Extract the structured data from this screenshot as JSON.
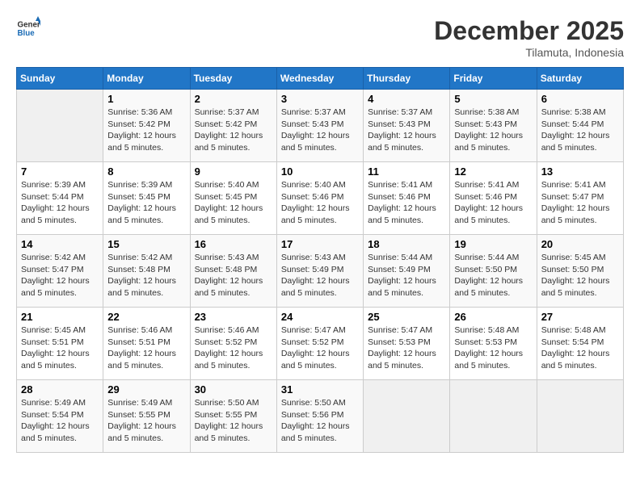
{
  "header": {
    "logo_general": "General",
    "logo_blue": "Blue",
    "month": "December 2025",
    "location": "Tilamuta, Indonesia"
  },
  "columns": [
    "Sunday",
    "Monday",
    "Tuesday",
    "Wednesday",
    "Thursday",
    "Friday",
    "Saturday"
  ],
  "weeks": [
    [
      {
        "day": "",
        "info": ""
      },
      {
        "day": "1",
        "info": "Sunrise: 5:36 AM\nSunset: 5:42 PM\nDaylight: 12 hours\nand 5 minutes."
      },
      {
        "day": "2",
        "info": "Sunrise: 5:37 AM\nSunset: 5:42 PM\nDaylight: 12 hours\nand 5 minutes."
      },
      {
        "day": "3",
        "info": "Sunrise: 5:37 AM\nSunset: 5:43 PM\nDaylight: 12 hours\nand 5 minutes."
      },
      {
        "day": "4",
        "info": "Sunrise: 5:37 AM\nSunset: 5:43 PM\nDaylight: 12 hours\nand 5 minutes."
      },
      {
        "day": "5",
        "info": "Sunrise: 5:38 AM\nSunset: 5:43 PM\nDaylight: 12 hours\nand 5 minutes."
      },
      {
        "day": "6",
        "info": "Sunrise: 5:38 AM\nSunset: 5:44 PM\nDaylight: 12 hours\nand 5 minutes."
      }
    ],
    [
      {
        "day": "7",
        "info": "Sunrise: 5:39 AM\nSunset: 5:44 PM\nDaylight: 12 hours\nand 5 minutes."
      },
      {
        "day": "8",
        "info": "Sunrise: 5:39 AM\nSunset: 5:45 PM\nDaylight: 12 hours\nand 5 minutes."
      },
      {
        "day": "9",
        "info": "Sunrise: 5:40 AM\nSunset: 5:45 PM\nDaylight: 12 hours\nand 5 minutes."
      },
      {
        "day": "10",
        "info": "Sunrise: 5:40 AM\nSunset: 5:46 PM\nDaylight: 12 hours\nand 5 minutes."
      },
      {
        "day": "11",
        "info": "Sunrise: 5:41 AM\nSunset: 5:46 PM\nDaylight: 12 hours\nand 5 minutes."
      },
      {
        "day": "12",
        "info": "Sunrise: 5:41 AM\nSunset: 5:46 PM\nDaylight: 12 hours\nand 5 minutes."
      },
      {
        "day": "13",
        "info": "Sunrise: 5:41 AM\nSunset: 5:47 PM\nDaylight: 12 hours\nand 5 minutes."
      }
    ],
    [
      {
        "day": "14",
        "info": "Sunrise: 5:42 AM\nSunset: 5:47 PM\nDaylight: 12 hours\nand 5 minutes."
      },
      {
        "day": "15",
        "info": "Sunrise: 5:42 AM\nSunset: 5:48 PM\nDaylight: 12 hours\nand 5 minutes."
      },
      {
        "day": "16",
        "info": "Sunrise: 5:43 AM\nSunset: 5:48 PM\nDaylight: 12 hours\nand 5 minutes."
      },
      {
        "day": "17",
        "info": "Sunrise: 5:43 AM\nSunset: 5:49 PM\nDaylight: 12 hours\nand 5 minutes."
      },
      {
        "day": "18",
        "info": "Sunrise: 5:44 AM\nSunset: 5:49 PM\nDaylight: 12 hours\nand 5 minutes."
      },
      {
        "day": "19",
        "info": "Sunrise: 5:44 AM\nSunset: 5:50 PM\nDaylight: 12 hours\nand 5 minutes."
      },
      {
        "day": "20",
        "info": "Sunrise: 5:45 AM\nSunset: 5:50 PM\nDaylight: 12 hours\nand 5 minutes."
      }
    ],
    [
      {
        "day": "21",
        "info": "Sunrise: 5:45 AM\nSunset: 5:51 PM\nDaylight: 12 hours\nand 5 minutes."
      },
      {
        "day": "22",
        "info": "Sunrise: 5:46 AM\nSunset: 5:51 PM\nDaylight: 12 hours\nand 5 minutes."
      },
      {
        "day": "23",
        "info": "Sunrise: 5:46 AM\nSunset: 5:52 PM\nDaylight: 12 hours\nand 5 minutes."
      },
      {
        "day": "24",
        "info": "Sunrise: 5:47 AM\nSunset: 5:52 PM\nDaylight: 12 hours\nand 5 minutes."
      },
      {
        "day": "25",
        "info": "Sunrise: 5:47 AM\nSunset: 5:53 PM\nDaylight: 12 hours\nand 5 minutes."
      },
      {
        "day": "26",
        "info": "Sunrise: 5:48 AM\nSunset: 5:53 PM\nDaylight: 12 hours\nand 5 minutes."
      },
      {
        "day": "27",
        "info": "Sunrise: 5:48 AM\nSunset: 5:54 PM\nDaylight: 12 hours\nand 5 minutes."
      }
    ],
    [
      {
        "day": "28",
        "info": "Sunrise: 5:49 AM\nSunset: 5:54 PM\nDaylight: 12 hours\nand 5 minutes."
      },
      {
        "day": "29",
        "info": "Sunrise: 5:49 AM\nSunset: 5:55 PM\nDaylight: 12 hours\nand 5 minutes."
      },
      {
        "day": "30",
        "info": "Sunrise: 5:50 AM\nSunset: 5:55 PM\nDaylight: 12 hours\nand 5 minutes."
      },
      {
        "day": "31",
        "info": "Sunrise: 5:50 AM\nSunset: 5:56 PM\nDaylight: 12 hours\nand 5 minutes."
      },
      {
        "day": "",
        "info": ""
      },
      {
        "day": "",
        "info": ""
      },
      {
        "day": "",
        "info": ""
      }
    ]
  ]
}
